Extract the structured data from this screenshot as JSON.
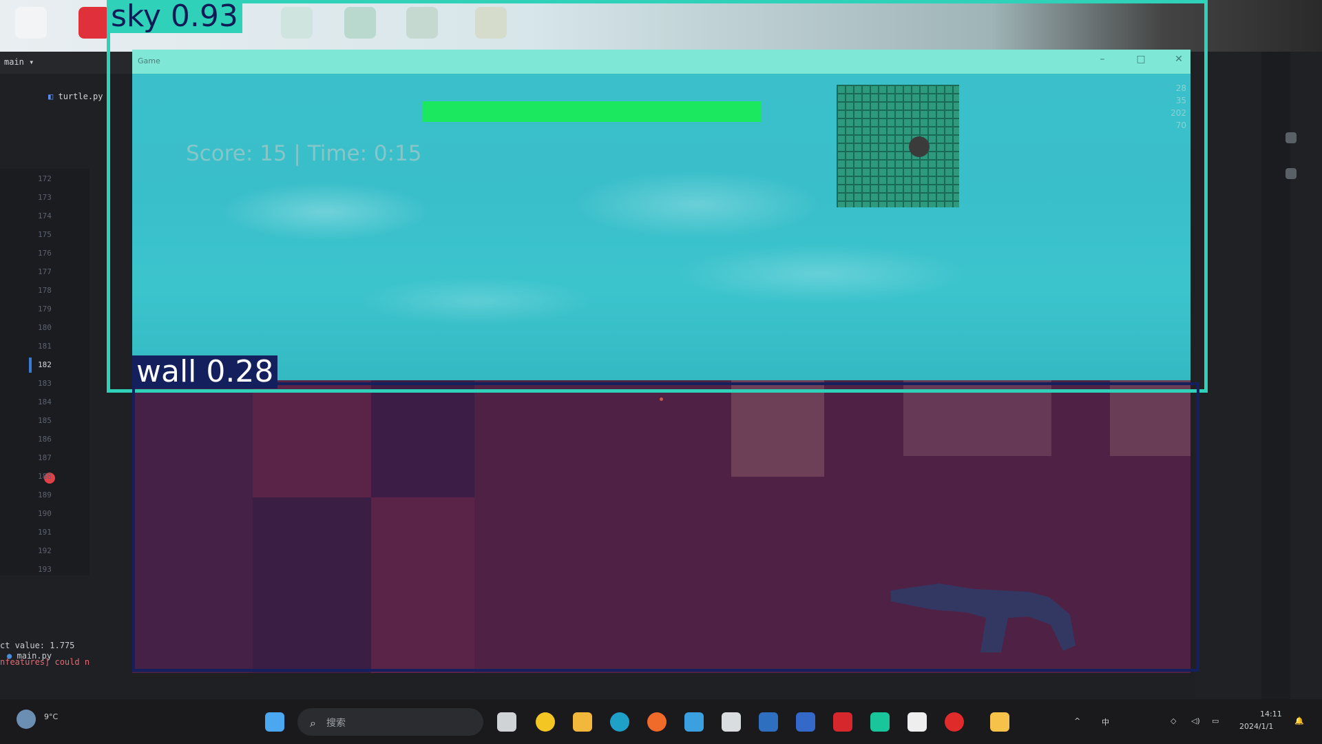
{
  "desktop": {
    "background": "desktop wallpaper"
  },
  "ide": {
    "project_label": "main",
    "file_tab": "turtle.py",
    "line_numbers": [
      "172",
      "173",
      "174",
      "175",
      "176",
      "177",
      "178",
      "179",
      "180",
      "181",
      "182",
      "183",
      "184",
      "185",
      "186",
      "187",
      "188",
      "189",
      "190",
      "191",
      "192",
      "193"
    ],
    "active_line": "182",
    "console_line_1": "ct value: 1.775",
    "console_line_2": "nfeatures] could n",
    "run_tab": "main.py"
  },
  "game_window": {
    "title": "Game",
    "minimize_glyph": "–",
    "maximize_glyph": "□",
    "close_glyph": "✕",
    "hud": {
      "score_time": "Score: 15 | Time: 0:15",
      "fps_lines": [
        "28",
        "35",
        "202",
        "70"
      ]
    },
    "health_bar_fill": 1.0
  },
  "detections": [
    {
      "label": "sky  0.93",
      "color": "#2fd2b8"
    },
    {
      "label": "wall  0.28",
      "color": "#14205e"
    }
  ],
  "taskbar": {
    "search_placeholder": "搜索",
    "tray_clock": "14:11",
    "tray_date": "2024/1/1",
    "tray_lang": "中",
    "weather": "9°C"
  },
  "colors": {
    "sky_tint": "#3bc0cb",
    "floor_tint": "#4f2145",
    "health": "#1be85e",
    "title_bar": "#7fe7d6"
  }
}
